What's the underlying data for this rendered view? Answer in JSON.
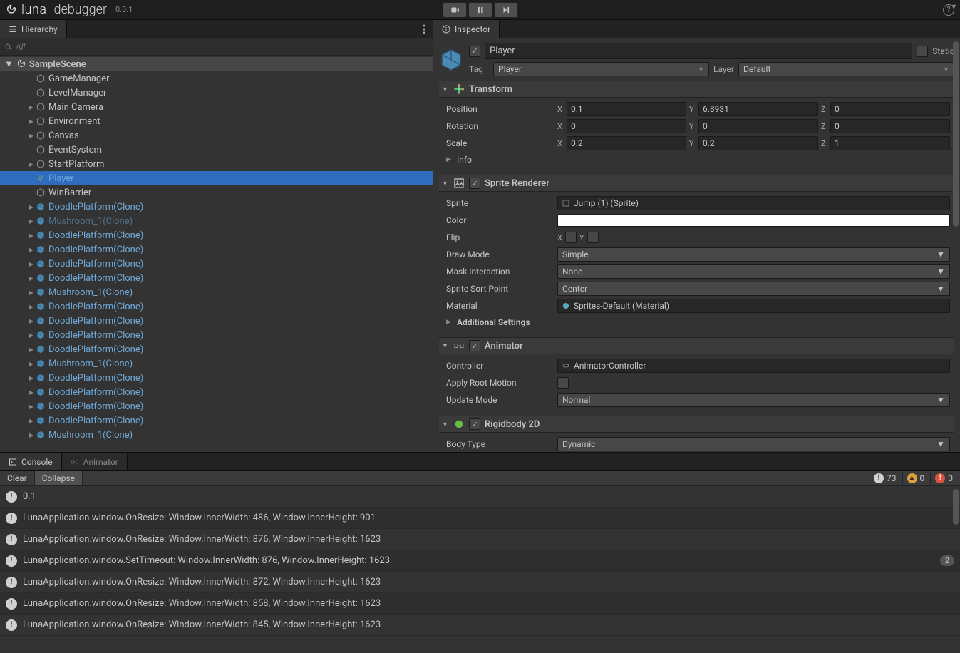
{
  "app": {
    "name": "luna",
    "subtitle": "debugger",
    "version": "0.3.1"
  },
  "tabs": {
    "hierarchy": "Hierarchy",
    "inspector": "Inspector",
    "console": "Console",
    "animator": "Animator"
  },
  "search": {
    "placeholder": "All"
  },
  "scene": "SampleScene",
  "hierarchyItems": [
    {
      "label": "GameManager",
      "depth": 1,
      "toggle": "",
      "prefab": false
    },
    {
      "label": "LevelManager",
      "depth": 1,
      "toggle": "",
      "prefab": false
    },
    {
      "label": "Main Camera",
      "depth": 1,
      "toggle": "▶",
      "prefab": false
    },
    {
      "label": "Environment",
      "depth": 1,
      "toggle": "▶",
      "prefab": false
    },
    {
      "label": "Canvas",
      "depth": 1,
      "toggle": "▶",
      "prefab": false
    },
    {
      "label": "EventSystem",
      "depth": 1,
      "toggle": "",
      "prefab": false
    },
    {
      "label": "StartPlatform",
      "depth": 1,
      "toggle": "▶",
      "prefab": false
    },
    {
      "label": "Player",
      "depth": 1,
      "toggle": "",
      "prefab": true,
      "selected": true
    },
    {
      "label": "WinBarrier",
      "depth": 1,
      "toggle": "",
      "prefab": false
    },
    {
      "label": "DoodlePlatform(Clone)",
      "depth": 1,
      "toggle": "▶",
      "prefab": true
    },
    {
      "label": "Mushroom_1(Clone)",
      "depth": 1,
      "toggle": "▶",
      "prefab": true,
      "dim": true
    },
    {
      "label": "DoodlePlatform(Clone)",
      "depth": 1,
      "toggle": "▶",
      "prefab": true
    },
    {
      "label": "DoodlePlatform(Clone)",
      "depth": 1,
      "toggle": "▶",
      "prefab": true
    },
    {
      "label": "DoodlePlatform(Clone)",
      "depth": 1,
      "toggle": "▶",
      "prefab": true
    },
    {
      "label": "DoodlePlatform(Clone)",
      "depth": 1,
      "toggle": "▶",
      "prefab": true
    },
    {
      "label": "Mushroom_1(Clone)",
      "depth": 1,
      "toggle": "▶",
      "prefab": true
    },
    {
      "label": "DoodlePlatform(Clone)",
      "depth": 1,
      "toggle": "▶",
      "prefab": true
    },
    {
      "label": "DoodlePlatform(Clone)",
      "depth": 1,
      "toggle": "▶",
      "prefab": true
    },
    {
      "label": "DoodlePlatform(Clone)",
      "depth": 1,
      "toggle": "▶",
      "prefab": true
    },
    {
      "label": "DoodlePlatform(Clone)",
      "depth": 1,
      "toggle": "▶",
      "prefab": true
    },
    {
      "label": "Mushroom_1(Clone)",
      "depth": 1,
      "toggle": "▶",
      "prefab": true
    },
    {
      "label": "DoodlePlatform(Clone)",
      "depth": 1,
      "toggle": "▶",
      "prefab": true
    },
    {
      "label": "DoodlePlatform(Clone)",
      "depth": 1,
      "toggle": "▶",
      "prefab": true
    },
    {
      "label": "DoodlePlatform(Clone)",
      "depth": 1,
      "toggle": "▶",
      "prefab": true
    },
    {
      "label": "DoodlePlatform(Clone)",
      "depth": 1,
      "toggle": "▶",
      "prefab": true
    },
    {
      "label": "Mushroom_1(Clone)",
      "depth": 1,
      "toggle": "▶",
      "prefab": true
    }
  ],
  "inspector": {
    "objectName": "Player",
    "activeChecked": true,
    "staticLabel": "Static",
    "tagLabel": "Tag",
    "tagValue": "Player",
    "layerLabel": "Layer",
    "layerValue": "Default",
    "transform": {
      "title": "Transform",
      "position": {
        "label": "Position",
        "x": "0.1",
        "y": "6.8931",
        "z": "0"
      },
      "rotation": {
        "label": "Rotation",
        "x": "0",
        "y": "0",
        "z": "0"
      },
      "scale": {
        "label": "Scale",
        "x": "0.2",
        "y": "0.2",
        "z": "1"
      },
      "info": "Info"
    },
    "spriteRenderer": {
      "title": "Sprite Renderer",
      "spriteLabel": "Sprite",
      "spriteValue": "Jump (1) (Sprite)",
      "colorLabel": "Color",
      "flipLabel": "Flip",
      "flipX": "X",
      "flipY": "Y",
      "drawModeLabel": "Draw Mode",
      "drawModeValue": "Simple",
      "maskLabel": "Mask Interaction",
      "maskValue": "None",
      "sortLabel": "Sprite Sort Point",
      "sortValue": "Center",
      "materialLabel": "Material",
      "materialValue": "Sprites-Default (Material)",
      "additional": "Additional Settings"
    },
    "animator": {
      "title": "Animator",
      "controllerLabel": "Controller",
      "controllerValue": "AnimatorController",
      "rootMotionLabel": "Apply Root Motion",
      "updateModeLabel": "Update Mode",
      "updateModeValue": "Normal"
    },
    "rigidbody": {
      "title": "Rigidbody 2D",
      "bodyTypeLabel": "Body Type",
      "bodyTypeValue": "Dynamic"
    }
  },
  "console": {
    "clear": "Clear",
    "collapse": "Collapse",
    "counters": {
      "info": "73",
      "warn": "0",
      "error": "0"
    },
    "logs": [
      {
        "msg": "0.1",
        "count": ""
      },
      {
        "msg": "LunaApplication.window.OnResize: Window.InnerWidth: 486, Window.InnerHeight: 901",
        "count": ""
      },
      {
        "msg": "LunaApplication.window.OnResize: Window.InnerWidth: 876, Window.InnerHeight: 1623",
        "count": ""
      },
      {
        "msg": "LunaApplication.window.SetTimeout: Window.InnerWidth: 876, Window.InnerHeight: 1623",
        "count": "2"
      },
      {
        "msg": "LunaApplication.window.OnResize: Window.InnerWidth: 872, Window.InnerHeight: 1623",
        "count": ""
      },
      {
        "msg": "LunaApplication.window.OnResize: Window.InnerWidth: 858, Window.InnerHeight: 1623",
        "count": ""
      },
      {
        "msg": "LunaApplication.window.OnResize: Window.InnerWidth: 845, Window.InnerHeight: 1623",
        "count": ""
      }
    ]
  }
}
